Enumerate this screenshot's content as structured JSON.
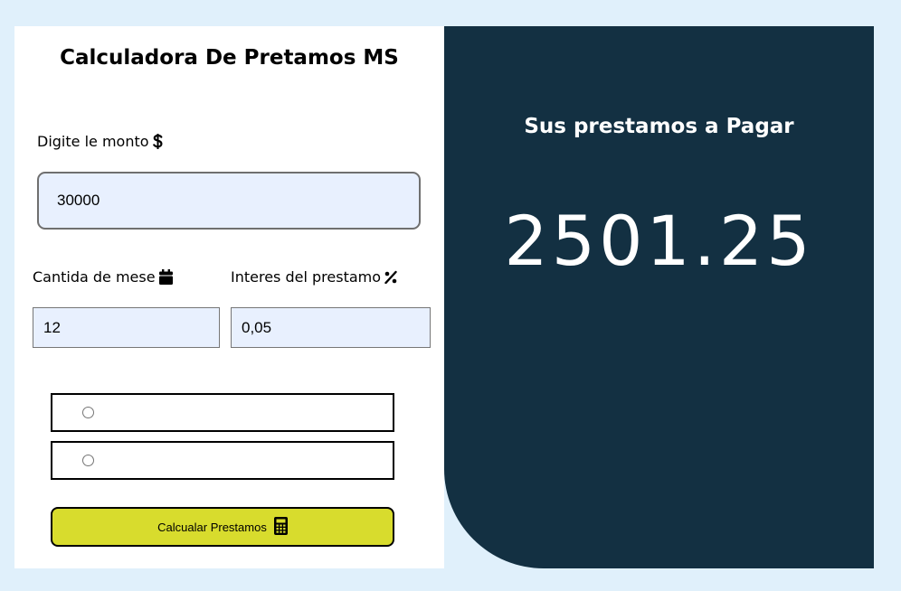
{
  "form": {
    "title": "Calculadora De Pretamos MS",
    "amount": {
      "label": "Digite le monto",
      "icon": "dollar-icon",
      "value": "30000"
    },
    "months": {
      "label": "Cantida de mese",
      "icon": "calendar-icon",
      "value": "12"
    },
    "interest": {
      "label": "Interes del prestamo",
      "icon": "percent-icon",
      "value": "0,05"
    },
    "radio_options": [
      {
        "label": "",
        "checked": false
      },
      {
        "label": "",
        "checked": false
      }
    ],
    "calculate_button": {
      "label": "Calcualar Prestamos",
      "icon": "calculator-icon",
      "color": "#d8dc2d"
    }
  },
  "result": {
    "title": "Sus prestamos a Pagar",
    "value": "2501.25",
    "panel_color": "#133042"
  }
}
